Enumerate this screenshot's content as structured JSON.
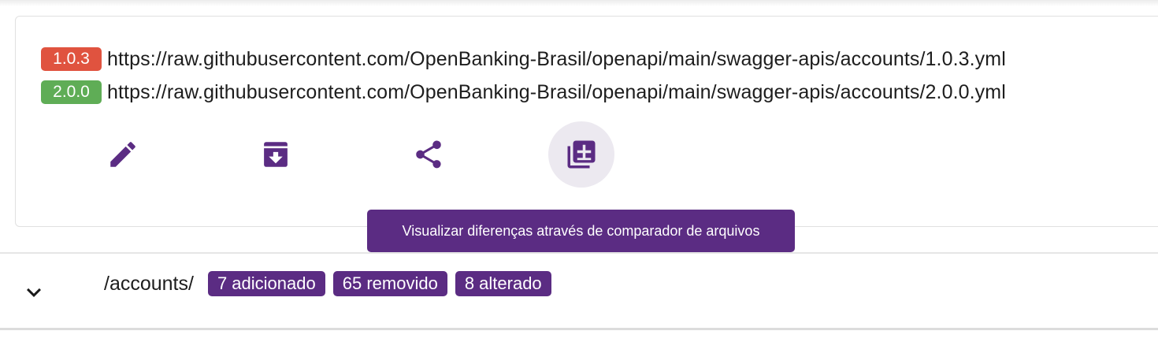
{
  "versions": [
    {
      "label": "1.0.3",
      "color": "#e0533f",
      "url": "https://raw.githubusercontent.com/OpenBanking-Brasil/openapi/main/swagger-apis/accounts/1.0.3.yml"
    },
    {
      "label": "2.0.0",
      "color": "#5fad56",
      "url": "https://raw.githubusercontent.com/OpenBanking-Brasil/openapi/main/swagger-apis/accounts/2.0.0.yml"
    }
  ],
  "actions": {
    "edit_icon": "pencil-icon",
    "archive_icon": "archive-download-icon",
    "share_icon": "share-icon",
    "compare_icon": "library-add-icon"
  },
  "tooltip": "Visualizar diferenças através de comparador de arquivos",
  "endpoint": {
    "path": "/accounts/",
    "added": "7 adicionado",
    "removed": "65 removido",
    "changed": "8 alterado"
  },
  "colors": {
    "accent": "#5b2c83",
    "badge_old": "#e0533f",
    "badge_new": "#5fad56"
  }
}
